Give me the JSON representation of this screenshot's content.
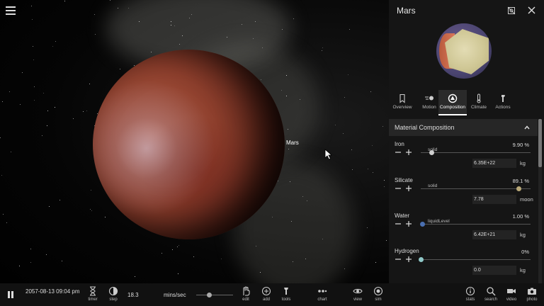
{
  "scene": {
    "object_label": "Mars"
  },
  "panel": {
    "title": "Mars",
    "tabs": [
      {
        "label": "Overview",
        "icon": "bookmark-icon"
      },
      {
        "label": "Motion",
        "icon": "orbit-icon"
      },
      {
        "label": "Composition",
        "icon": "composition-icon"
      },
      {
        "label": "Climate",
        "icon": "thermometer-icon"
      },
      {
        "label": "Actions",
        "icon": "hammer-icon"
      }
    ],
    "active_tab": "Composition",
    "section_title": "Material Composition",
    "materials": [
      {
        "name": "Iron",
        "state": "solid",
        "percent": "9.90 %",
        "value": "6.35E+22",
        "unit": "kg",
        "level": 0.099,
        "color": "#cfcfcf"
      },
      {
        "name": "Silicate",
        "state": "solid",
        "percent": "89.1 %",
        "value": "7.78",
        "unit": "moon",
        "level": 0.891,
        "color": "#b8a878"
      },
      {
        "name": "Water",
        "state": "liquidLevel",
        "percent": "1.00 %",
        "value": "6.42E+21",
        "unit": "kg",
        "level": 0.01,
        "color": "#4a6fb0"
      },
      {
        "name": "Hydrogen",
        "state": "",
        "percent": "0%",
        "value": "0.0",
        "unit": "kg",
        "level": 0.0,
        "color": "#8fc8c8"
      }
    ]
  },
  "bottombar": {
    "datetime": "2057-08-13 09:04 pm",
    "timer_label": "timer",
    "step_label": "step",
    "speed_value": "18.3",
    "speed_unit": "mins/sec",
    "speed_level": 0.35,
    "tools": [
      {
        "label": "edit",
        "icon": "hand-icon"
      },
      {
        "label": "add",
        "icon": "plus-circle-icon"
      },
      {
        "label": "tools",
        "icon": "hammer-icon"
      },
      {
        "label": "chart",
        "icon": "chart-icon"
      },
      {
        "label": "view",
        "icon": "eye-icon"
      },
      {
        "label": "sim",
        "icon": "sim-icon"
      }
    ],
    "right": [
      {
        "label": "stats",
        "icon": "info-icon"
      },
      {
        "label": "search",
        "icon": "search-icon"
      },
      {
        "label": "video",
        "icon": "video-camera-icon"
      },
      {
        "label": "photo",
        "icon": "camera-icon"
      }
    ]
  }
}
